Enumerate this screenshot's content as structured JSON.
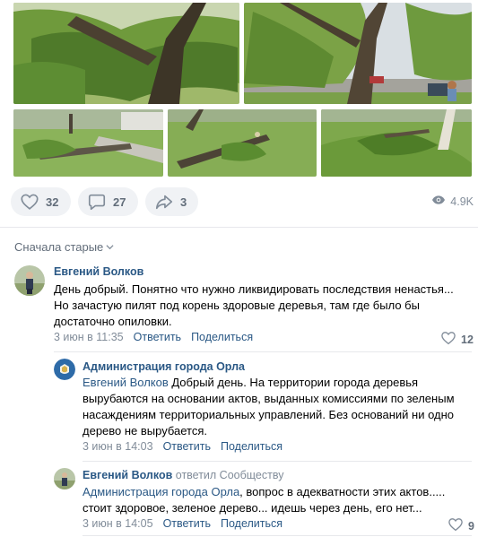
{
  "post": {
    "photos": [
      "photo-1",
      "photo-2",
      "photo-3",
      "photo-4",
      "photo-5"
    ],
    "likes": "32",
    "comments": "27",
    "shares": "3",
    "views": "4.9K"
  },
  "sort_label": "Сначала старые",
  "comments": [
    {
      "author": "Евгений Волков",
      "lines": [
        "День добрый. Понятно что нужно ликвидировать последствия ненастья...",
        "Но зачастую пилят под корень здоровые деревья, там где было бы",
        "достаточно опиловки."
      ],
      "date": "3 июн в 11:35",
      "reply": "Ответить",
      "share": "Поделиться",
      "likes": "12"
    },
    {
      "author": "Администрация города Орла",
      "mention": "Евгений Волков",
      "first_line": " Добрый день. На территории города деревья",
      "lines": [
        "вырубаются на основании актов, выданных комиссиями по зеленым",
        "насаждениям территориальных управлений. Без оснований ни одно",
        "дерево не вырубается."
      ],
      "date": "3 июн в 14:03",
      "reply": "Ответить",
      "share": "Поделиться"
    },
    {
      "author": "Евгений Волков",
      "replied_to": "ответил Сообществу",
      "mention": "Администрация города Орла",
      "first_line": ", вопрос в адекватности этих актов.....",
      "lines": [
        "стоит здоровое, зеленое дерево... идешь через день, его нет..."
      ],
      "date": "3 июн в 14:05",
      "reply": "Ответить",
      "share": "Поделиться",
      "likes": "9"
    }
  ],
  "colors": {
    "link": "#2a5885",
    "muted": "#818c99",
    "pill_bg": "#f0f2f5",
    "divider": "#e7e8ec"
  },
  "icons": [
    "heart-icon",
    "comment-icon",
    "share-icon",
    "eye-icon",
    "chevron-down-icon"
  ]
}
